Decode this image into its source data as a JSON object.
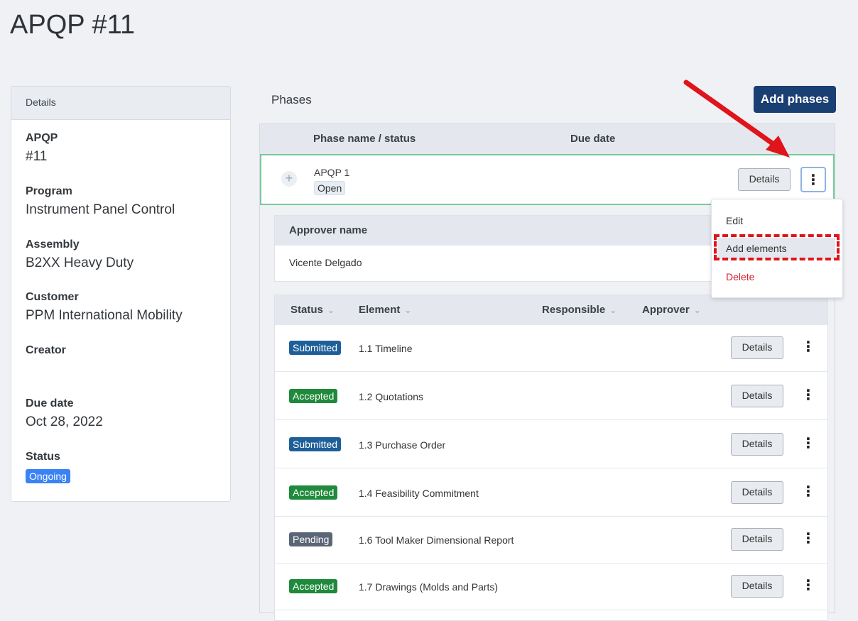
{
  "page": {
    "title": "APQP #11"
  },
  "details": {
    "header": "Details",
    "fields": [
      {
        "label": "APQP",
        "value": "#11"
      },
      {
        "label": "Program",
        "value": "Instrument Panel Control"
      },
      {
        "label": "Assembly",
        "value": "B2XX Heavy Duty"
      },
      {
        "label": "Customer",
        "value": "PPM International Mobility"
      },
      {
        "label": "Creator",
        "value": ""
      },
      {
        "label": "Due date",
        "value": "Oct 28, 2022"
      },
      {
        "label": "Status",
        "value": "Ongoing"
      }
    ]
  },
  "phases": {
    "title": "Phases",
    "add_button": "Add phases",
    "columns": {
      "name_status": "Phase name / status",
      "due_date": "Due date"
    },
    "phase": {
      "name": "APQP 1",
      "status": "Open",
      "details_button": "Details"
    },
    "approvers": {
      "header": "Approver name",
      "name": "Vicente Delgado"
    },
    "elements": {
      "columns": [
        "Status",
        "Element",
        "Responsible",
        "Approver"
      ],
      "rows": [
        {
          "status": "Submitted",
          "name": "1.1 Timeline",
          "details": "Details"
        },
        {
          "status": "Accepted",
          "name": "1.2 Quotations",
          "details": "Details"
        },
        {
          "status": "Submitted",
          "name": "1.3 Purchase Order",
          "details": "Details"
        },
        {
          "status": "Accepted",
          "name": "1.4 Feasibility Commitment",
          "details": "Details"
        },
        {
          "status": "Pending",
          "name": "1.6 Tool Maker Dimensional Report",
          "details": "Details"
        },
        {
          "status": "Accepted",
          "name": "1.7 Drawings (Molds and Parts)",
          "details": "Details"
        }
      ]
    }
  },
  "menu": {
    "edit": "Edit",
    "add_elements": "Add elements",
    "delete": "Delete"
  },
  "colors": {
    "primary": "#1a3f72",
    "submitted": "#1f5f99",
    "accepted": "#1f8a3b",
    "pending": "#5a6576",
    "ongoing": "#3b82f6",
    "annotation": "#e0141b"
  }
}
